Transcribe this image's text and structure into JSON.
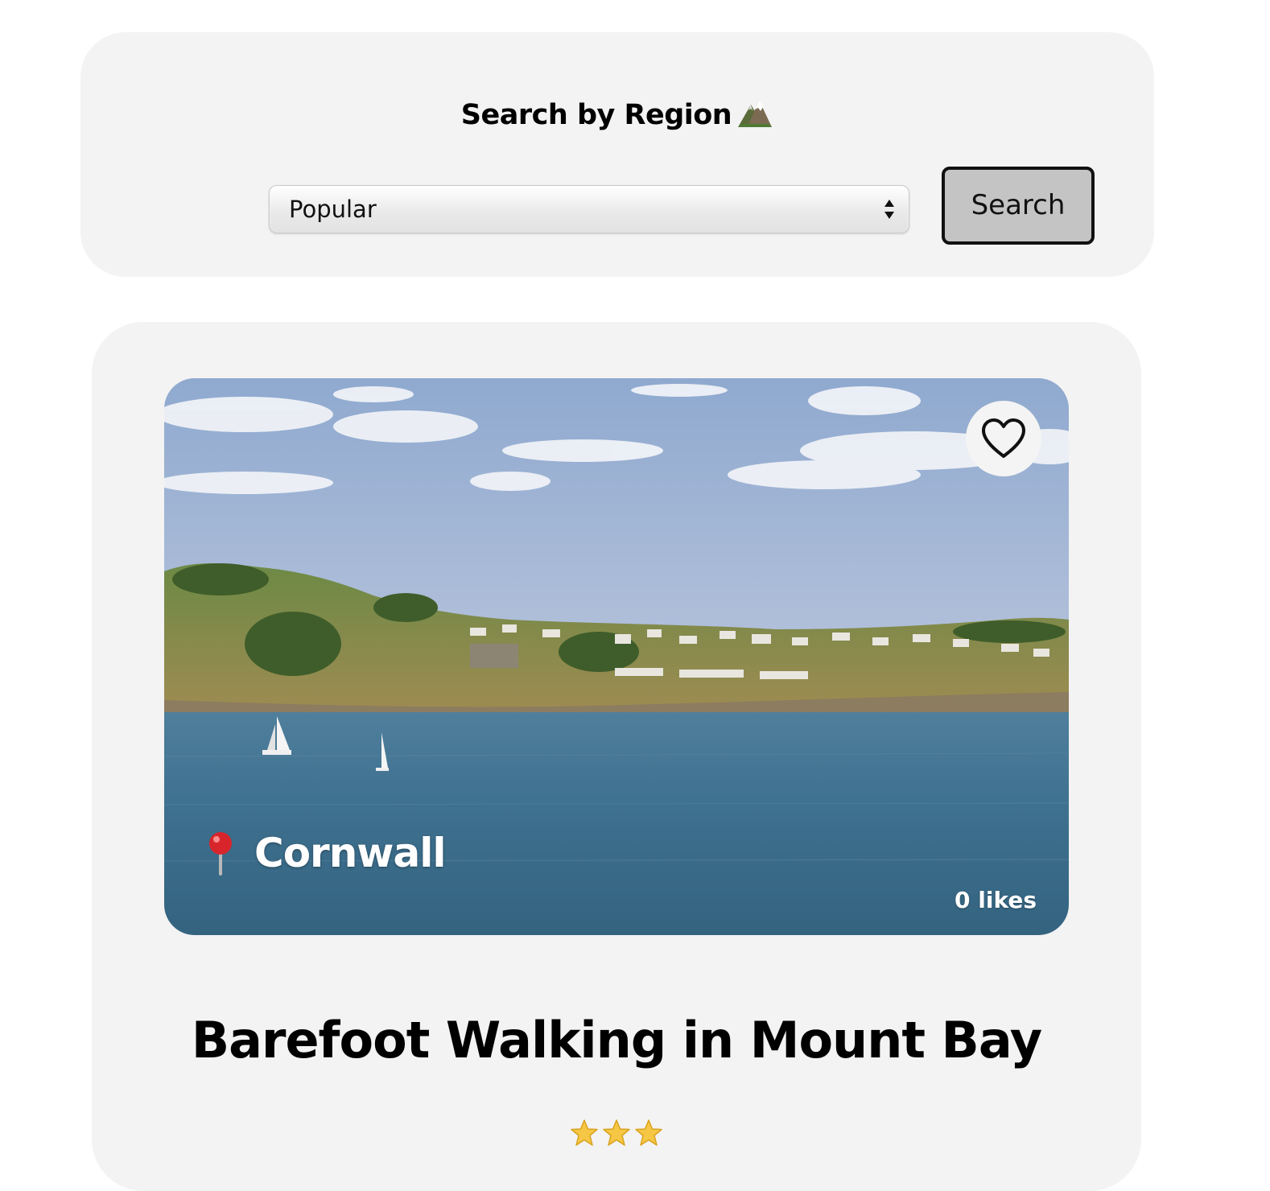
{
  "search": {
    "title": "Search by Region",
    "title_icon": "mountain-icon",
    "selected_region": "Popular",
    "button_label": "Search"
  },
  "walk_card": {
    "location_icon": "pin-icon",
    "location": "Cornwall",
    "likes_label": "0 likes",
    "favorite_icon": "heart-outline-icon",
    "title": "Barefoot Walking in Mount Bay",
    "rating": 3,
    "rating_max": 3,
    "star_icon": "star-icon"
  },
  "colors": {
    "panel_background": "#f3f3f3",
    "button_background": "#c4c4c4",
    "star": "#f6c744",
    "pin": "#d8252c"
  }
}
